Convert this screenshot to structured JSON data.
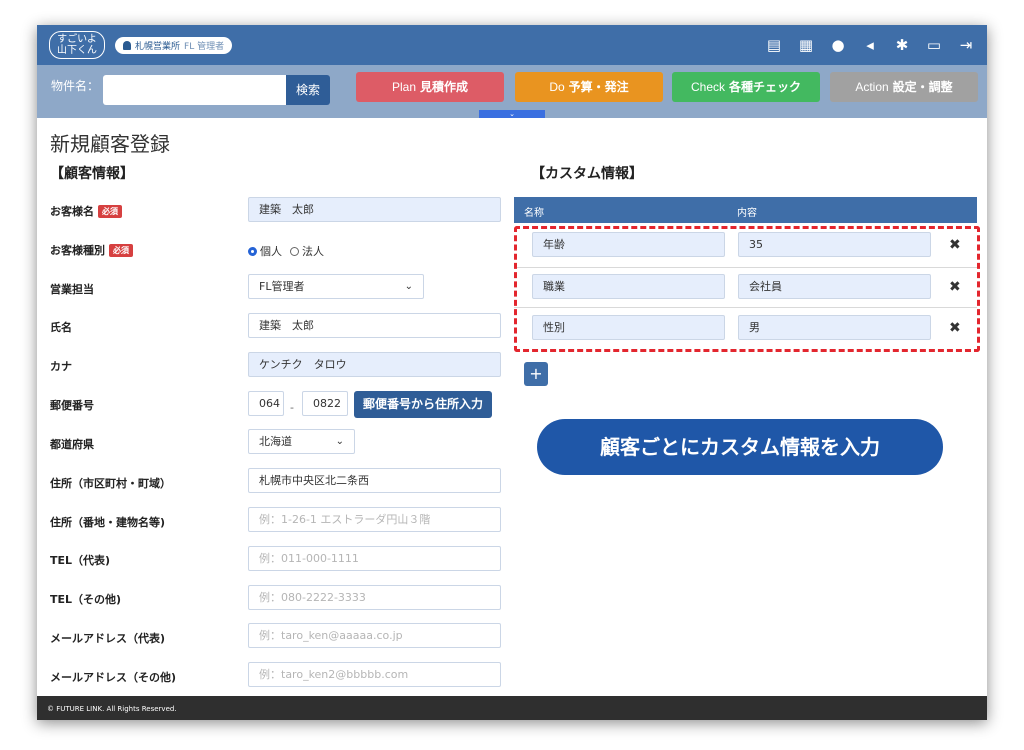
{
  "app": {
    "logo_line1": "すごいよ",
    "logo_line2": "山下くん",
    "office": "札幌営業所",
    "role": "FL 管理者"
  },
  "top_icons": [
    "document-icon",
    "calendar-icon",
    "chat-icon",
    "megaphone-icon",
    "gear-icon",
    "folder-icon",
    "logout-icon"
  ],
  "subbar": {
    "property_label": "物件名：",
    "search_label": "検索",
    "phases": [
      {
        "en": "Plan",
        "jp": "見積作成",
        "color": "#dd5c66"
      },
      {
        "en": "Do",
        "jp": "予算・発注",
        "color": "#e99420"
      },
      {
        "en": "Check",
        "jp": "各種チェック",
        "color": "#43b960"
      },
      {
        "en": "Action",
        "jp": "設定・調整",
        "color": "#a1a1a1"
      }
    ],
    "collapse": "⌄"
  },
  "page_title": "新規顧客登録",
  "customer": {
    "section_title": "【顧客情報】",
    "required_badge": "必須",
    "name_label": "お客様名",
    "name_value": "建築　太郎",
    "type_label": "お客様種別",
    "type_options": [
      "個人",
      "法人"
    ],
    "sales_label": "営業担当",
    "sales_value": "FL管理者",
    "fullname_label": "氏名",
    "fullname_value": "建築　太郎",
    "kana_label": "カナ",
    "kana_value": "ケンチク　タロウ",
    "zip_label": "郵便番号",
    "zip1": "064",
    "zip_sep": "-",
    "zip2": "0822",
    "zip_button": "郵便番号から住所入力",
    "pref_label": "都道府県",
    "pref_value": "北海道",
    "addr1_label": "住所（市区町村・町域）",
    "addr1_value": "札幌市中央区北二条西",
    "addr2_label": "住所（番地・建物名等)",
    "addr2_placeholder": "例：1-26-1 エストラーダ円山３階",
    "tel1_label": "TEL（代表)",
    "tel1_placeholder": "例：011-000-1111",
    "tel2_label": "TEL（その他)",
    "tel2_placeholder": "例：080-2222-3333",
    "mail1_label": "メールアドレス（代表)",
    "mail1_placeholder": "例：taro_ken@aaaaa.co.jp",
    "mail2_label": "メールアドレス（その他)",
    "mail2_placeholder": "例：taro_ken2@bbbbb.com"
  },
  "custom": {
    "section_title": "【カスタム情報】",
    "col_name": "名称",
    "col_content": "内容",
    "rows": [
      {
        "name": "年齢",
        "content": "35"
      },
      {
        "name": "職業",
        "content": "会社員"
      },
      {
        "name": "性別",
        "content": "男"
      }
    ],
    "delete_glyph": "✖",
    "add_glyph": "+",
    "callout": "顧客ごとにカスタム情報を入力"
  },
  "footer": "© FUTURE LINK. All Rights Reserved."
}
